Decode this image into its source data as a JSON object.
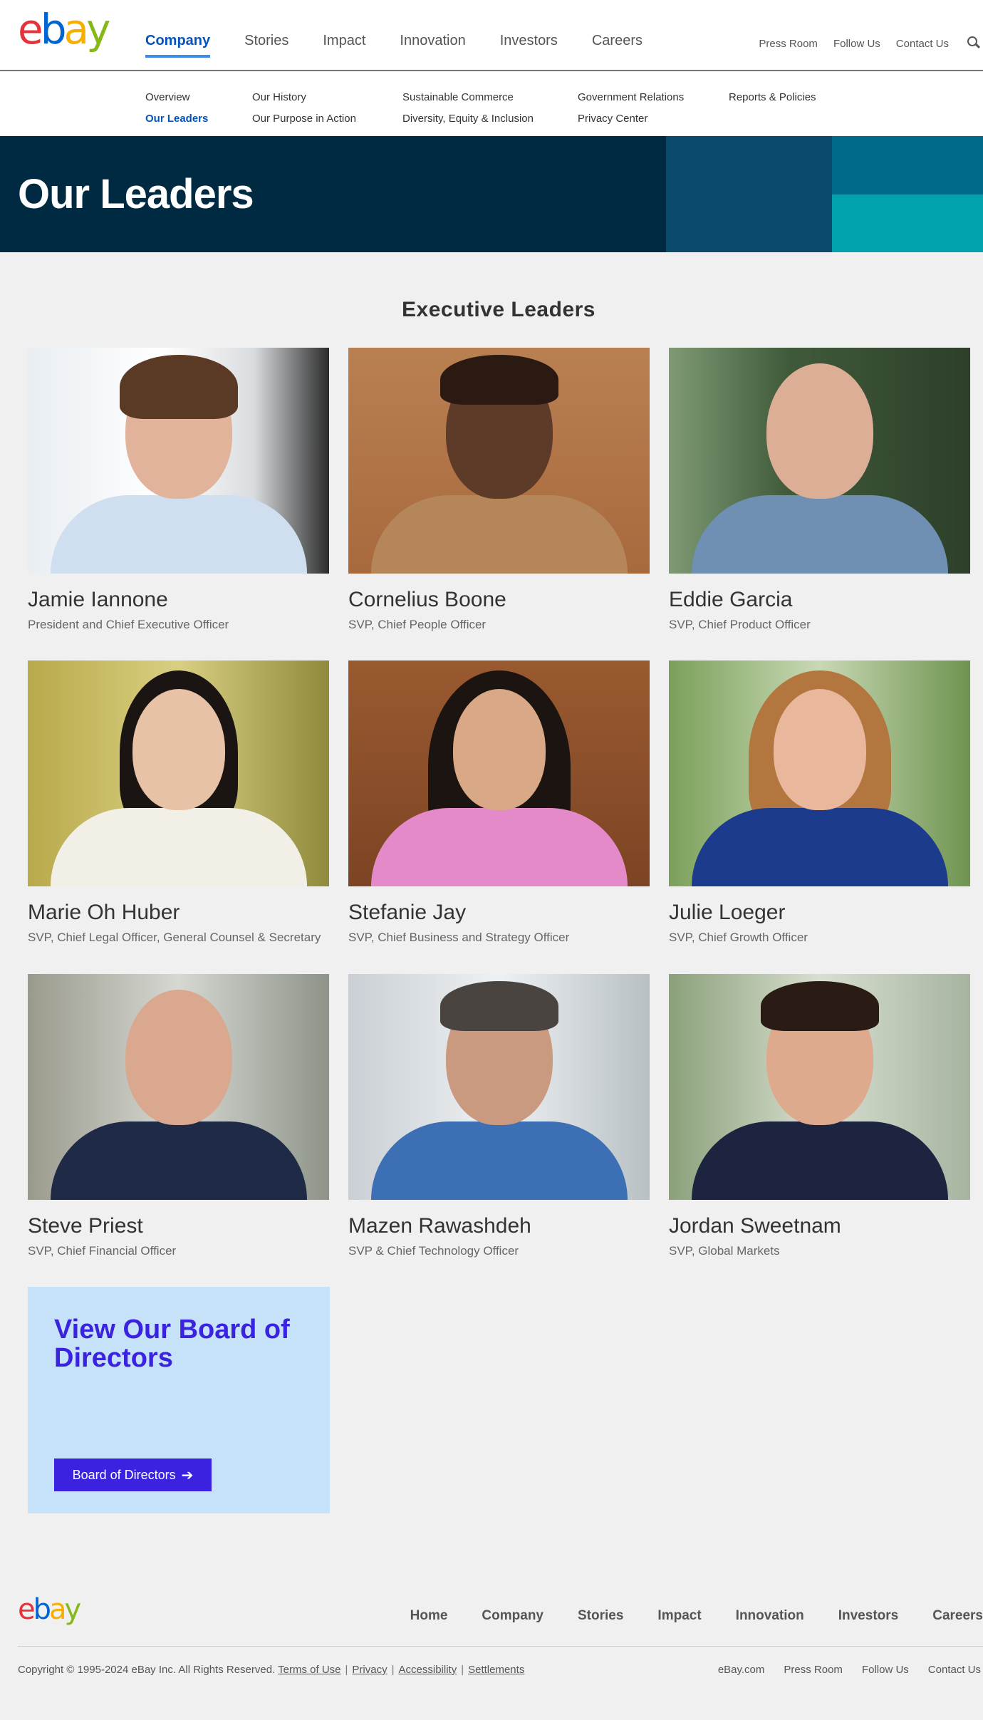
{
  "brand": {
    "logo_text": "ebay",
    "colors": {
      "e": "#e53238",
      "b": "#0064d2",
      "a": "#f5af02",
      "y": "#86b817"
    }
  },
  "header": {
    "main_nav": [
      "Company",
      "Stories",
      "Impact",
      "Innovation",
      "Investors",
      "Careers"
    ],
    "active_item": "Company",
    "utility_nav": [
      "Press Room",
      "Follow Us",
      "Contact Us"
    ],
    "search_icon": "search-icon"
  },
  "subnav": {
    "columns": [
      [
        "Overview",
        "Our Leaders"
      ],
      [
        "Our History",
        "Our Purpose in Action"
      ],
      [
        "Sustainable Commerce",
        "Diversity, Equity & Inclusion"
      ],
      [
        "Government Relations",
        "Privacy Center"
      ],
      [
        "Reports & Policies"
      ]
    ],
    "active_item": "Our Leaders"
  },
  "hero": {
    "title": "Our Leaders",
    "colors": [
      "#002a42",
      "#0a4a6d",
      "#006a8a",
      "#00a2ad"
    ]
  },
  "section": {
    "title": "Executive Leaders"
  },
  "leaders": [
    {
      "name": "Jamie Iannone",
      "role": "President and Chief Executive Officer"
    },
    {
      "name": "Cornelius Boone",
      "role": "SVP, Chief People Officer"
    },
    {
      "name": "Eddie Garcia",
      "role": "SVP, Chief Product Officer"
    },
    {
      "name": "Marie Oh Huber",
      "role": "SVP, Chief Legal Officer, General Counsel & Secretary"
    },
    {
      "name": "Stefanie Jay",
      "role": "SVP, Chief Business and Strategy Officer"
    },
    {
      "name": "Julie Loeger",
      "role": "SVP, Chief Growth Officer"
    },
    {
      "name": "Steve Priest",
      "role": "SVP, Chief Financial Officer"
    },
    {
      "name": "Mazen Rawashdeh",
      "role": "SVP & Chief Technology Officer"
    },
    {
      "name": "Jordan Sweetnam",
      "role": "SVP, Global Markets"
    }
  ],
  "board_cta": {
    "heading": "View Our Board of Directors",
    "button_label": "Board of Directors",
    "button_icon": "arrow-right-icon"
  },
  "footer": {
    "nav": [
      "Home",
      "Company",
      "Stories",
      "Impact",
      "Innovation",
      "Investors",
      "Careers"
    ],
    "copyright": "Copyright © 1995-2024 eBay Inc. All Rights Reserved.",
    "legal_links": [
      "Terms of Use",
      "Privacy",
      "Accessibility",
      "Settlements"
    ],
    "utility": [
      "eBay.com",
      "Press Room",
      "Follow Us",
      "Contact Us"
    ]
  }
}
